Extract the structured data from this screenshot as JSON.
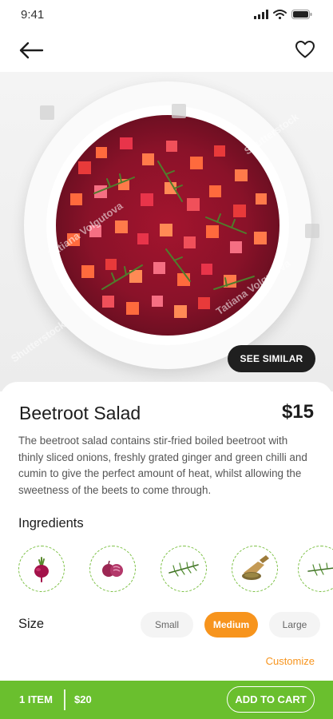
{
  "status_bar": {
    "time": "9:41"
  },
  "icons": {
    "back": "arrow-left-icon",
    "favorite": "heart-icon",
    "signal": "signal-icon",
    "wifi": "wifi-icon",
    "battery": "battery-icon"
  },
  "hero": {
    "see_similar_label": "SEE SIMILAR",
    "watermarks": [
      "Shutterstock",
      "Tatiana Volgutova",
      "Tatiana Volgutova",
      "Shutterstock"
    ]
  },
  "dish": {
    "title": "Beetroot Salad",
    "price": "$15",
    "description": "The beetroot salad contains stir-fried boiled beetroot with thinly sliced onions, freshly grated ginger and green chilli and cumin to give the perfect amount of heat, whilst allowing the sweetness of the beets to come through."
  },
  "ingredients": {
    "title": "Ingredients",
    "items": [
      "beetroot-icon",
      "red-onion-icon",
      "dill-icon",
      "cumin-icon",
      "herb-icon"
    ]
  },
  "size": {
    "label": "Size",
    "options": [
      "Small",
      "Medium",
      "Large"
    ],
    "selected": "Medium"
  },
  "customize_label": "Customize",
  "cart": {
    "count_label": "1 ITEM",
    "total": "$20",
    "button_label": "ADD TO CART"
  },
  "colors": {
    "accent": "#f7941d",
    "cart_bar": "#6abf2e",
    "ingredient_border": "#7bc043",
    "dark_pill": "#1f1f1f"
  }
}
